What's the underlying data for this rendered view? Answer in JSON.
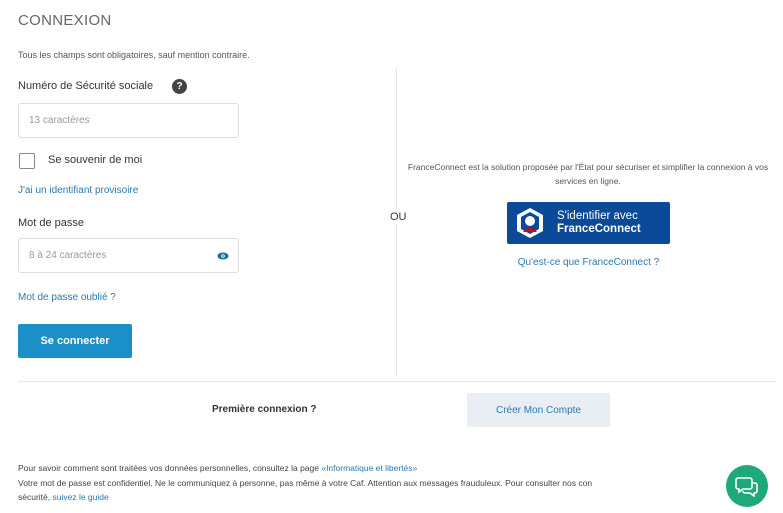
{
  "header": {
    "title": "CONNEXION"
  },
  "form": {
    "required_note": "Tous les champs sont obligatoires, sauf mention contraire.",
    "nss_label": "Numéro de Sécurité sociale",
    "nss_placeholder": "13 caractères",
    "remember_label": "Se souvenir de moi",
    "remember_checked": false,
    "temp_id_link": "J'ai un identifiant provisoire",
    "password_label": "Mot de passe",
    "password_placeholder": "8 à 24 caractères",
    "forgot_link": "Mot de passe oublié ?",
    "login_button": "Se connecter"
  },
  "separator": {
    "label": "OU"
  },
  "franceconnect": {
    "description": "FranceConnect est la solution proposée par l'État pour sécuriser et simplifier la connexion à vos services en ligne.",
    "button_line1": "S'identifier avec",
    "button_line2": "FranceConnect",
    "what_link": "Qu'est-ce que FranceConnect ?",
    "brand_color": "#0a4a99"
  },
  "signup": {
    "question": "Première connexion ?",
    "create_button": "Créer Mon Compte"
  },
  "footer": {
    "line1": "Pour savoir comment sont traitées vos données personnelles, consultez la page ",
    "line1_link": "«Informatique et libertés»",
    "line2": "Votre mot de passe est confidentiel. Ne le communiquez à personne, pas même à votre Caf. Attention aux messages frauduleux. Pour consulter nos con",
    "line3_prefix": "sécurité, ",
    "line3_link": "suivez le guide"
  },
  "chat": {
    "icon": "chat-bubbles-icon",
    "color": "#1fa97a"
  }
}
